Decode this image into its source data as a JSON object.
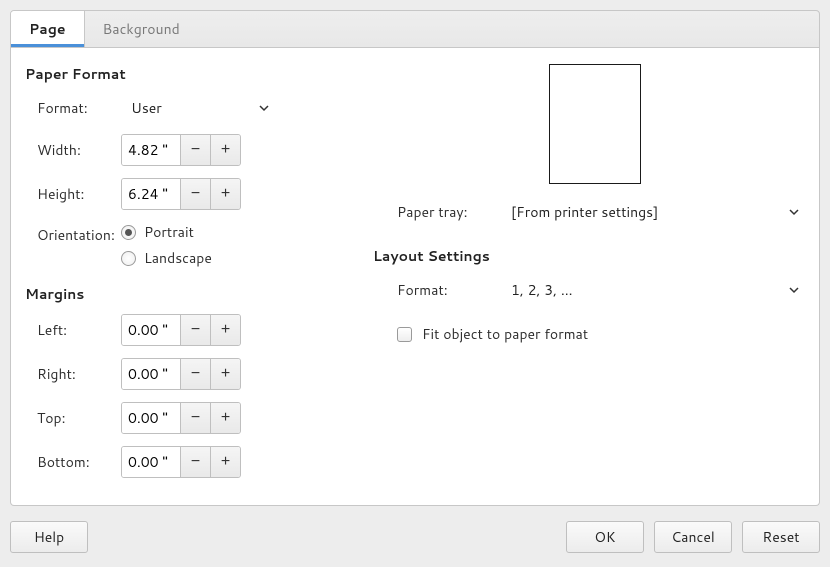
{
  "tabs": {
    "page": "Page",
    "background": "Background"
  },
  "paperFormat": {
    "title": "Paper Format",
    "formatLabel": "Format:",
    "formatValue": "User",
    "widthLabel": "Width:",
    "widthValue": "4.82 \"",
    "heightLabel": "Height:",
    "heightValue": "6.24 \"",
    "orientationLabel": "Orientation:",
    "portrait": "Portrait",
    "landscape": "Landscape"
  },
  "margins": {
    "title": "Margins",
    "leftLabel": "Left:",
    "leftValue": "0.00 \"",
    "rightLabel": "Right:",
    "rightValue": "0.00 \"",
    "topLabel": "Top:",
    "topValue": "0.00 \"",
    "bottomLabel": "Bottom:",
    "bottomValue": "0.00 \""
  },
  "rightSide": {
    "paperTrayLabel": "Paper tray:",
    "paperTrayValue": "[From printer settings]",
    "layoutTitle": "Layout Settings",
    "layoutFormatLabel": "Format:",
    "layoutFormatValue": "1, 2, 3, ...",
    "fitObject": "Fit object to paper format"
  },
  "buttons": {
    "help": "Help",
    "ok": "OK",
    "cancel": "Cancel",
    "reset": "Reset"
  },
  "glyphs": {
    "minus": "−",
    "plus": "+"
  }
}
